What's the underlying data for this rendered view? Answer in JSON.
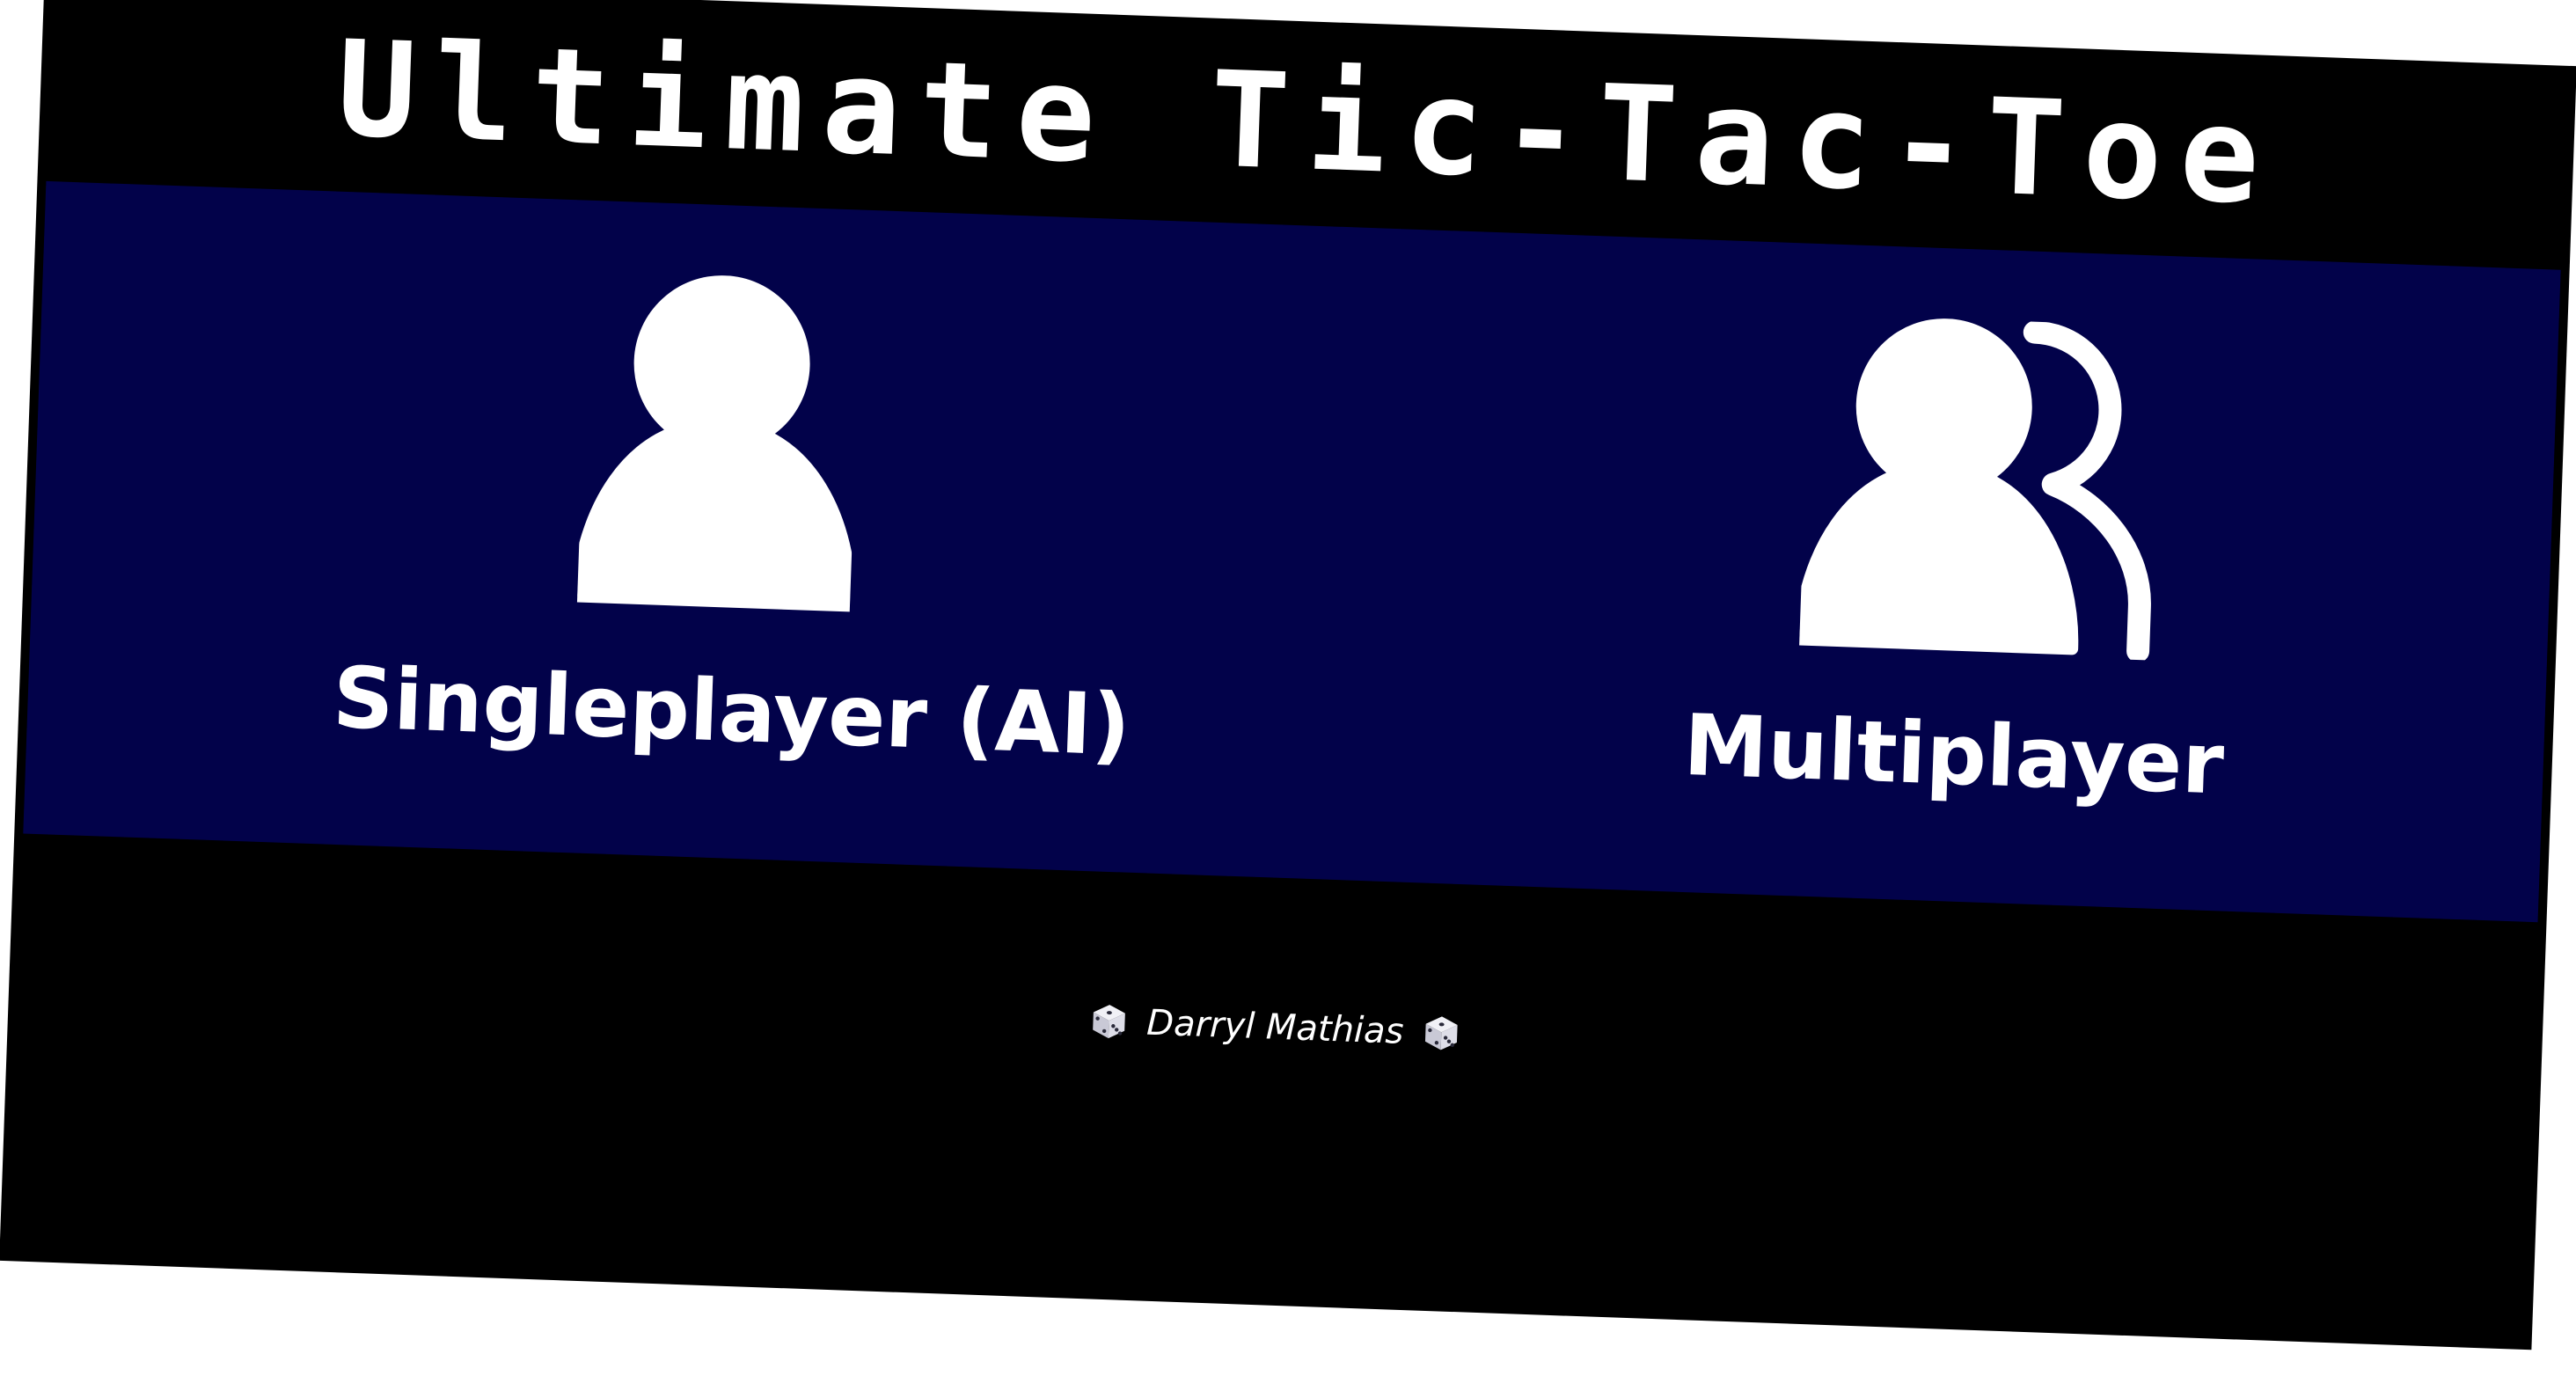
{
  "app": {
    "title": "Ultimate Tic-Tac-Toe"
  },
  "modes": [
    {
      "label": "Singleplayer (AI)",
      "icon": "single-user-icon"
    },
    {
      "label": "Multiplayer",
      "icon": "multi-user-icon"
    }
  ],
  "footer": {
    "author": "Darryl Mathias",
    "icon": "dice-icon"
  },
  "colors": {
    "background": "#000000",
    "band": "#02024a",
    "text": "#ffffff"
  }
}
